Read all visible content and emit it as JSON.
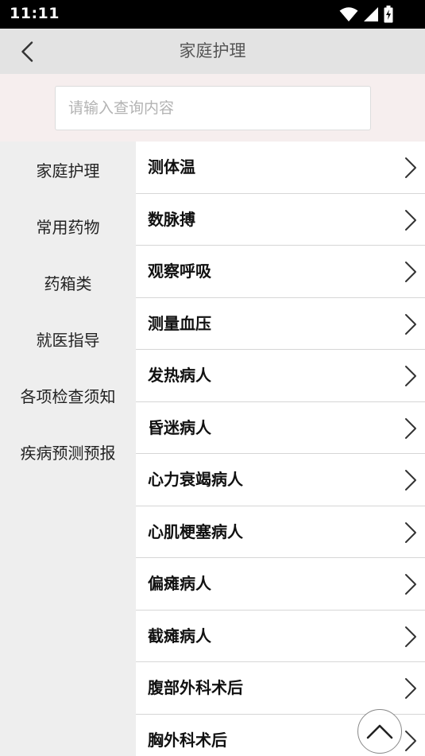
{
  "status_bar": {
    "time": "11:11",
    "icons": [
      "wifi-icon",
      "signal-icon",
      "battery-icon"
    ]
  },
  "header": {
    "title": "家庭护理",
    "back_icon": "chevron-left-icon"
  },
  "search": {
    "value": "",
    "placeholder": "请输入查询内容"
  },
  "sidebar": {
    "categories": [
      {
        "label": "家庭护理",
        "selected": true
      },
      {
        "label": "常用药物",
        "selected": false
      },
      {
        "label": "药箱类",
        "selected": false
      },
      {
        "label": "就医指导",
        "selected": false
      },
      {
        "label": "各项检查须知",
        "selected": false
      },
      {
        "label": "疾病预测预报",
        "selected": false
      }
    ]
  },
  "content": {
    "items": [
      {
        "label": "测体温"
      },
      {
        "label": "数脉搏"
      },
      {
        "label": "观察呼吸"
      },
      {
        "label": "测量血压"
      },
      {
        "label": "发热病人"
      },
      {
        "label": "昏迷病人"
      },
      {
        "label": "心力衰竭病人"
      },
      {
        "label": "心肌梗塞病人"
      },
      {
        "label": "偏瘫病人"
      },
      {
        "label": "截瘫病人"
      },
      {
        "label": "腹部外科术后"
      },
      {
        "label": "胸外科术后"
      }
    ],
    "item_icon": "chevron-right-icon"
  },
  "scroll_top": {
    "icon": "chevron-up-icon"
  },
  "colors": {
    "status_bar": "#000000",
    "title_bar": "#e3e3e3",
    "search_area": "#f6eeee",
    "sidebar": "#eeeeee",
    "divider": "#d6d6d6"
  }
}
